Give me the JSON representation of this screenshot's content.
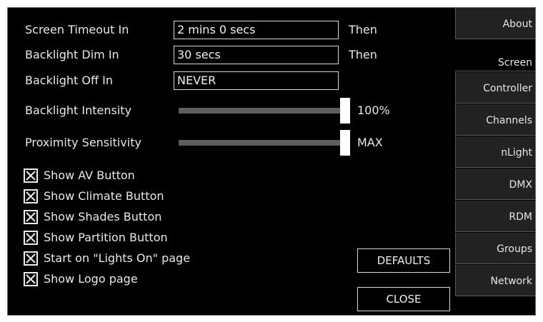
{
  "settings": {
    "screen_timeout": {
      "label": "Screen Timeout In",
      "value": "2 mins 0 secs",
      "suffix": "Then"
    },
    "backlight_dim": {
      "label": "Backlight Dim In",
      "value": "30 secs",
      "suffix": "Then"
    },
    "backlight_off": {
      "label": "Backlight Off In",
      "value": "NEVER"
    }
  },
  "sliders": {
    "backlight_intensity": {
      "label": "Backlight Intensity",
      "value_text": "100%",
      "level": 1.0
    },
    "proximity_sensitivity": {
      "label": "Proximity Sensitivity",
      "value_text": "MAX",
      "level": 1.0
    }
  },
  "checkboxes": [
    {
      "label": "Show AV Button",
      "checked": true
    },
    {
      "label": "Show Climate Button",
      "checked": true
    },
    {
      "label": "Show Shades Button",
      "checked": true
    },
    {
      "label": "Show Partition Button",
      "checked": true
    },
    {
      "label": "Start on \"Lights On\" page",
      "checked": true
    },
    {
      "label": "Show Logo page",
      "checked": true
    }
  ],
  "buttons": {
    "defaults": "DEFAULTS",
    "close": "CLOSE"
  },
  "tabs": [
    {
      "label": "About",
      "active": false
    },
    {
      "label": "Screen",
      "active": true
    },
    {
      "label": "Controller",
      "active": false
    },
    {
      "label": "Channels",
      "active": false
    },
    {
      "label": "nLight",
      "active": false
    },
    {
      "label": "DMX",
      "active": false
    },
    {
      "label": "RDM",
      "active": false
    },
    {
      "label": "Groups",
      "active": false
    },
    {
      "label": "Network",
      "active": false
    }
  ],
  "colors": {
    "background": "#000000",
    "tab_inactive": "#222222",
    "text": "#e6e6e6",
    "slider_track": "#5e5e5e"
  }
}
